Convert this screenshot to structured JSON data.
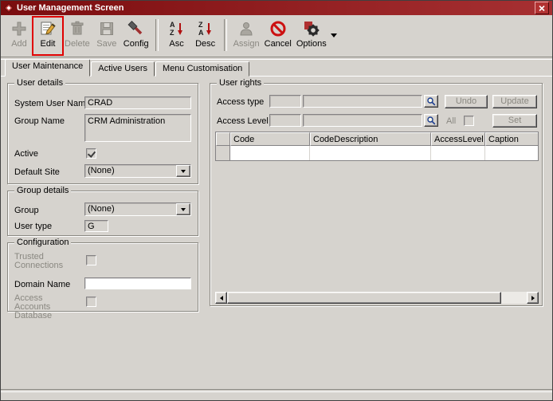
{
  "colors": {
    "titlebar_start": "#7a0c0e",
    "titlebar_end": "#a73032",
    "window_bg": "#d6d3ce",
    "highlight_box": "#e00000",
    "disabled_text": "#8a8881"
  },
  "window": {
    "title": "User Management Screen"
  },
  "toolbar": {
    "buttons": [
      {
        "label": "Add",
        "icon": "add-icon",
        "enabled": false
      },
      {
        "label": "Edit",
        "icon": "edit-icon",
        "enabled": true,
        "highlighted": true
      },
      {
        "label": "Delete",
        "icon": "delete-icon",
        "enabled": false
      },
      {
        "label": "Save",
        "icon": "save-icon",
        "enabled": false
      },
      {
        "label": "Config",
        "icon": "config-icon",
        "enabled": true
      },
      {
        "label": "Asc",
        "icon": "sort-asc-icon",
        "enabled": true
      },
      {
        "label": "Desc",
        "icon": "sort-desc-icon",
        "enabled": true
      },
      {
        "label": "Assign",
        "icon": "assign-icon",
        "enabled": false
      },
      {
        "label": "Cancel",
        "icon": "cancel-icon",
        "enabled": true
      },
      {
        "label": "Options",
        "icon": "options-icon",
        "enabled": true,
        "has_dropdown": true
      }
    ]
  },
  "tabs": {
    "items": [
      {
        "label": "User Maintenance",
        "active": true
      },
      {
        "label": "Active Users",
        "active": false
      },
      {
        "label": "Menu Customisation",
        "active": false
      }
    ]
  },
  "user_details": {
    "group_title": "User details",
    "system_user_name_label": "System User Name",
    "system_user_name_value": "CRAD",
    "group_name_label": "Group Name",
    "group_name_value": "CRM Administration",
    "active_label": "Active",
    "active_checked": true,
    "default_site_label": "Default Site",
    "default_site_value": "(None)"
  },
  "group_details": {
    "group_title": "Group details",
    "group_label": "Group",
    "group_value": "(None)",
    "user_type_label": "User type",
    "user_type_value": "G"
  },
  "configuration": {
    "group_title": "Configuration",
    "trusted_connections_label": "Trusted Connections",
    "trusted_connections_checked": false,
    "domain_name_label": "Domain Name",
    "domain_name_value": "",
    "access_accounts_label": "Access Accounts Database",
    "access_accounts_checked": false
  },
  "user_rights": {
    "group_title": "User rights",
    "access_type_label": "Access type",
    "access_type_code_value": "",
    "access_type_desc_value": "",
    "access_level_label": "Access Level",
    "access_level_code_value": "",
    "access_level_desc_value": "",
    "undo_label": "Undo",
    "update_label": "Update",
    "all_label": "All",
    "all_checked": false,
    "set_label": "Set",
    "grid_columns": [
      "",
      "Code",
      "CodeDescription",
      "AccessLevel",
      "Caption"
    ]
  }
}
